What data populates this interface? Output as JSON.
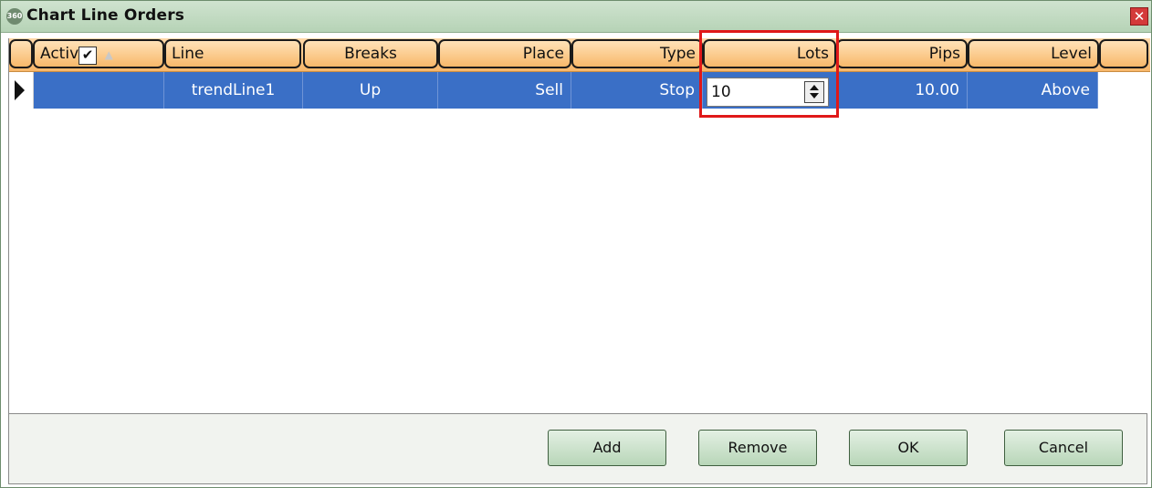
{
  "window": {
    "title": "Chart Line Orders",
    "app_icon_text": "360",
    "close_glyph": "✕"
  },
  "columns": [
    {
      "key": "active",
      "label": "Active"
    },
    {
      "key": "line",
      "label": "Line"
    },
    {
      "key": "breaks",
      "label": "Breaks"
    },
    {
      "key": "place",
      "label": "Place"
    },
    {
      "key": "type",
      "label": "Type"
    },
    {
      "key": "lots",
      "label": "Lots"
    },
    {
      "key": "pips",
      "label": "Pips"
    },
    {
      "key": "level",
      "label": "Level"
    }
  ],
  "sort_indicator": "▲",
  "rows": [
    {
      "active": true,
      "check_glyph": "✔",
      "line": "trendLine1",
      "breaks": "Up",
      "place": "Sell",
      "type": "Stop",
      "lots": "10",
      "pips": "10.00",
      "level": "Above"
    }
  ],
  "buttons": {
    "add": "Add",
    "remove": "Remove",
    "ok": "OK",
    "cancel": "Cancel"
  },
  "colors": {
    "selected_row": "#3a6fc6",
    "header": "#f7b76a",
    "titlebar": "#b6d3b6",
    "highlight": "#e01818"
  }
}
